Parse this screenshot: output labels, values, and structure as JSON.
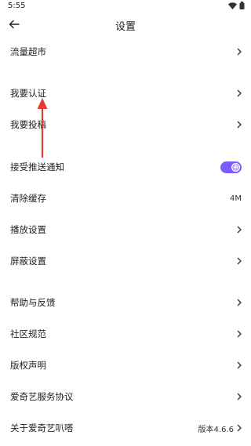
{
  "status_bar": {
    "time": "5:55"
  },
  "header": {
    "title": "设置"
  },
  "menu": {
    "items": [
      {
        "label": "流量超市"
      },
      {
        "label": "我要认证"
      },
      {
        "label": "我要投稿"
      },
      {
        "label": "接受推送通知",
        "toggle_on": true
      },
      {
        "label": "清除缓存",
        "value": "4M"
      },
      {
        "label": "播放设置"
      },
      {
        "label": "屏蔽设置"
      },
      {
        "label": "帮助与反馈"
      },
      {
        "label": "社区规范"
      },
      {
        "label": "版权声明"
      },
      {
        "label": "爱奇艺服务协议"
      },
      {
        "label": "关于爱奇艺叭嗒",
        "value": "版本4.6.6"
      }
    ]
  },
  "colors": {
    "accent": "#7c5cff",
    "annotation": "#e53935"
  },
  "icons": {
    "back": "back-arrow-icon",
    "chevron": "chevron-right-icon",
    "wifi": "wifi-icon",
    "battery": "battery-icon"
  }
}
